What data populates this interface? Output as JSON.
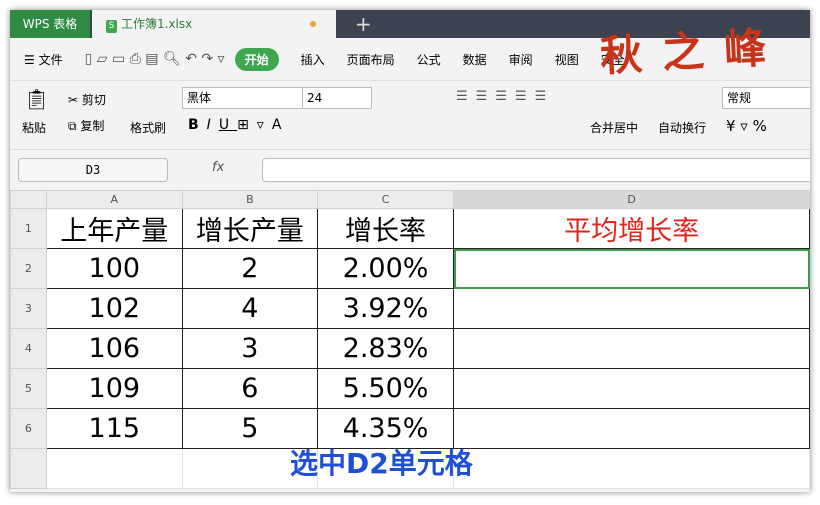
{
  "logo": "秋之峰",
  "tabs": {
    "app": "WPS 表格",
    "doc": "工作簿1.xlsx",
    "doc_icon": "S"
  },
  "menu": [
    "文件",
    "开始",
    "插入",
    "页面布局",
    "公式",
    "数据",
    "审阅",
    "视图",
    "安全"
  ],
  "ribbon": {
    "paste": "粘贴",
    "cut": "剪切",
    "copy": "复制",
    "format_painter": "格式刷",
    "font": "黑体",
    "size": "24",
    "merge": "合并居中",
    "wrap": "自动换行",
    "number_format": "常规"
  },
  "formula": {
    "name_box": "D3",
    "fx": "fx",
    "value": ""
  },
  "columns": [
    "A",
    "B",
    "C",
    "D"
  ],
  "rows": [
    {
      "n": "1",
      "cells": [
        "上年产量",
        "增长产量",
        "增长率",
        "平均增长率"
      ]
    },
    {
      "n": "2",
      "cells": [
        "100",
        "2",
        "2.00%",
        ""
      ]
    },
    {
      "n": "3",
      "cells": [
        "102",
        "4",
        "3.92%",
        ""
      ]
    },
    {
      "n": "4",
      "cells": [
        "106",
        "3",
        "2.83%",
        ""
      ]
    },
    {
      "n": "5",
      "cells": [
        "109",
        "6",
        "5.50%",
        ""
      ]
    },
    {
      "n": "6",
      "cells": [
        "115",
        "5",
        "4.35%",
        ""
      ]
    }
  ],
  "caption": "选中D2单元格"
}
